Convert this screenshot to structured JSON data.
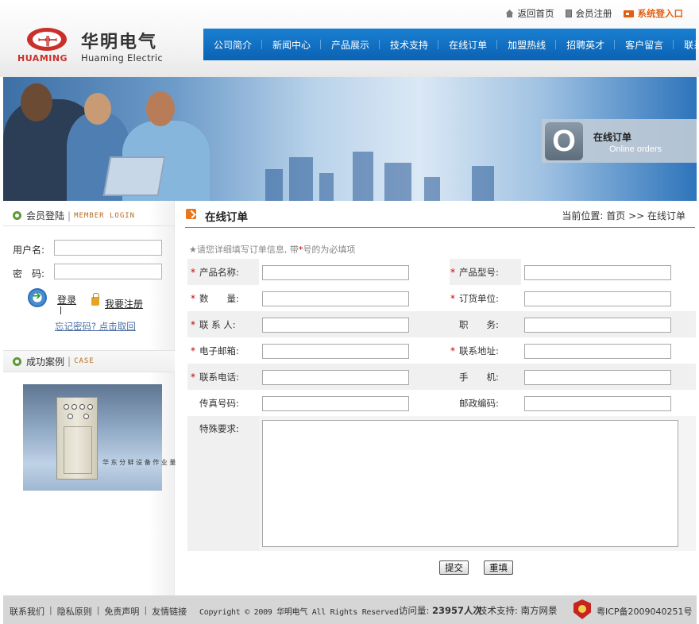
{
  "topbar": {
    "home_label": "返回首页",
    "register_label": "会员注册",
    "system_login_label": "系统登入口"
  },
  "logo": {
    "caps_text": "HUAMING",
    "cn_name": "华明电气",
    "en_name": "Huaming Electric"
  },
  "nav": {
    "items": [
      "公司简介",
      "新闻中心",
      "产品展示",
      "技术支持",
      "在线订单",
      "加盟热线",
      "招聘英才",
      "客户留言",
      "联系我们"
    ]
  },
  "banner": {
    "badge_letter": "O",
    "badge_cn": "在线订单",
    "badge_en": "Online orders"
  },
  "sidebar": {
    "member_title": "会员登陆",
    "member_en": "member login",
    "username_label": "用户名:",
    "password_label": "密　码:",
    "login_label": "登录",
    "register_label": "我要注册",
    "forgot_label": "忘记密码? 点击取回",
    "case_title": "成功案例",
    "case_en": "case",
    "case_caption": "华 东 分 蚌 设 备 作 业 量"
  },
  "main": {
    "title": "在线订单",
    "breadcrumb": "当前位置: 首页 >> 在线订单",
    "hint_prefix": "★请您详细填写订单信息, 带",
    "hint_star": "*",
    "hint_suffix": "号的为必填项",
    "form": {
      "rows": [
        {
          "left": {
            "label": "产品名称:",
            "required": true
          },
          "right": {
            "label": "产品型号:",
            "required": true
          }
        },
        {
          "left": {
            "label": "数　　量:",
            "required": true
          },
          "right": {
            "label": "订货单位:",
            "required": true
          }
        },
        {
          "left": {
            "label": "联 系 人:",
            "required": true
          },
          "right": {
            "label": "职　　务:",
            "required": false
          }
        },
        {
          "left": {
            "label": "电子邮箱:",
            "required": true
          },
          "right": {
            "label": "联系地址:",
            "required": true
          }
        },
        {
          "left": {
            "label": "联系电话:",
            "required": true
          },
          "right": {
            "label": "手　　机:",
            "required": false
          }
        },
        {
          "left": {
            "label": "传真号码:",
            "required": false
          },
          "right": {
            "label": "邮政编码:",
            "required": false
          }
        }
      ],
      "special_label": "特殊要求:",
      "submit_label": "提交",
      "reset_label": "重填"
    }
  },
  "footer": {
    "links": [
      "联系我们",
      "隐私原则",
      "免责声明",
      "友情链接"
    ],
    "copyright": "Copyright © 2009 华明电气 All Rights Reserved.",
    "visits_label": "访问量:",
    "visits_value": "23957人次",
    "support": "技术支持: 南方网景",
    "icp": "粤ICP备2009040251号"
  },
  "colors": {
    "nav_blue": "#0b62b3",
    "accent_orange": "#e45e12",
    "required_red": "#cc0000",
    "brand_red": "#c9302c"
  }
}
